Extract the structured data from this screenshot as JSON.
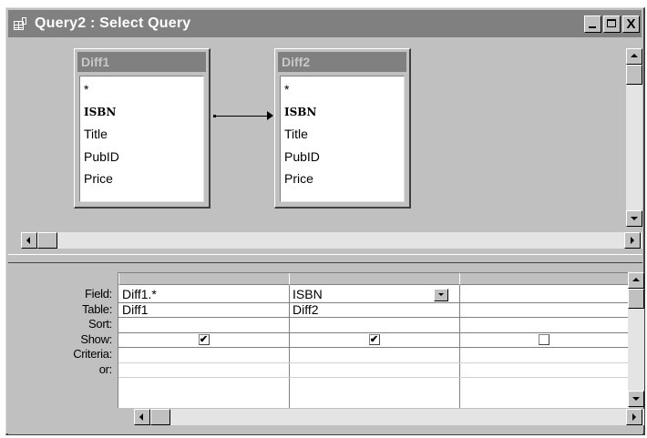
{
  "window": {
    "title": "Query2 : Select Query",
    "icon": "query-icon",
    "buttons": {
      "minimize_icon": "minimize-icon",
      "maximize_icon": "maximize-icon",
      "close_label": "X"
    }
  },
  "tables": [
    {
      "name": "Diff1",
      "fields": [
        "*",
        "ISBN",
        "Title",
        "PubID",
        "Price"
      ],
      "key_field": "ISBN"
    },
    {
      "name": "Diff2",
      "fields": [
        "*",
        "ISBN",
        "Title",
        "PubID",
        "Price"
      ],
      "key_field": "ISBN"
    }
  ],
  "join": {
    "from": "Diff1.ISBN",
    "to": "Diff2.ISBN"
  },
  "grid": {
    "row_labels": {
      "field": "Field:",
      "table": "Table:",
      "sort": "Sort:",
      "show": "Show:",
      "criteria": "Criteria:",
      "or": "or:"
    },
    "columns": [
      {
        "field": "Diff1.*",
        "table": "Diff1",
        "sort": "",
        "show": true,
        "criteria": "",
        "or": ""
      },
      {
        "field": "ISBN",
        "table": "Diff2",
        "sort": "",
        "show": true,
        "criteria": "",
        "or": "",
        "has_dropdown": true
      },
      {
        "field": "",
        "table": "",
        "sort": "",
        "show": false,
        "criteria": "",
        "or": ""
      }
    ]
  },
  "checkmark_glyph": "✔"
}
